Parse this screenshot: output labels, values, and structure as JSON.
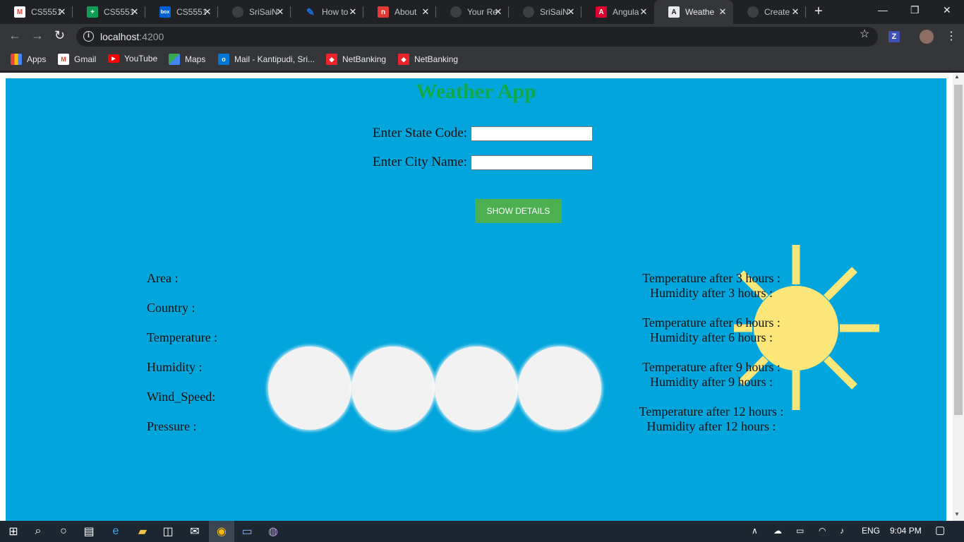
{
  "browser": {
    "tabs": [
      {
        "label": "CS5551",
        "icon": "gmail-icon",
        "color": "#ea4335"
      },
      {
        "label": "CS5551",
        "icon": "sheets-icon",
        "color": "#0f9d58"
      },
      {
        "label": "CS5551",
        "icon": "box-icon",
        "color": "#0061d5"
      },
      {
        "label": "SriSaiN",
        "icon": "github-icon",
        "color": "#5f6368"
      },
      {
        "label": "How to",
        "icon": "feather-icon",
        "color": "#1a73e8"
      },
      {
        "label": "About",
        "icon": "stack-icon",
        "color": "#e53935"
      },
      {
        "label": "Your Re",
        "icon": "github-icon",
        "color": "#5f6368"
      },
      {
        "label": "SriSaiN",
        "icon": "github-icon",
        "color": "#5f6368"
      },
      {
        "label": "Angula",
        "icon": "angular-icon",
        "color": "#dd0031"
      },
      {
        "label": "Weathe",
        "icon": "angular-active-icon",
        "color": "#e8eaed"
      },
      {
        "label": "Create",
        "icon": "github-icon",
        "color": "#5f6368"
      }
    ],
    "url": {
      "host": "localhost",
      "port": ":4200"
    },
    "bookmarks": [
      {
        "label": "Apps",
        "icon": "apps-grid-icon"
      },
      {
        "label": "Gmail",
        "icon": "gmail-icon"
      },
      {
        "label": "YouTube",
        "icon": "youtube-icon"
      },
      {
        "label": "Maps",
        "icon": "maps-icon"
      },
      {
        "label": "Mail - Kantipudi, Sri...",
        "icon": "outlook-icon"
      },
      {
        "label": "NetBanking",
        "icon": "bank-icon"
      },
      {
        "label": "NetBanking",
        "icon": "bank-icon"
      }
    ],
    "extension_label": "Z"
  },
  "app": {
    "title": "Weather App",
    "state_label": "Enter State Code:",
    "city_label": "Enter City Name:",
    "state_value": "",
    "city_value": "",
    "button_label": "SHOW DETAILS",
    "details": [
      "Area :",
      "Country :",
      "Temperature :",
      "Humidity :",
      "Wind_Speed:",
      "Pressure :"
    ],
    "forecast": [
      {
        "temp": "Temperature after 3 hours :",
        "hum": "Humidity after 3 hours :"
      },
      {
        "temp": "Temperature after 6 hours :",
        "hum": "Humidity after 6 hours :"
      },
      {
        "temp": "Temperature after 9 hours :",
        "hum": "Humidity after 9 hours :"
      },
      {
        "temp": "Temperature after 12 hours :",
        "hum": "Humidity after 12 hours :"
      }
    ],
    "colors": {
      "background": "#02a5dc",
      "title": "#11a84a",
      "button": "#4caf50",
      "sun": "#fbe67a"
    }
  },
  "taskbar": {
    "language": "ENG",
    "time": "9:04 PM"
  }
}
